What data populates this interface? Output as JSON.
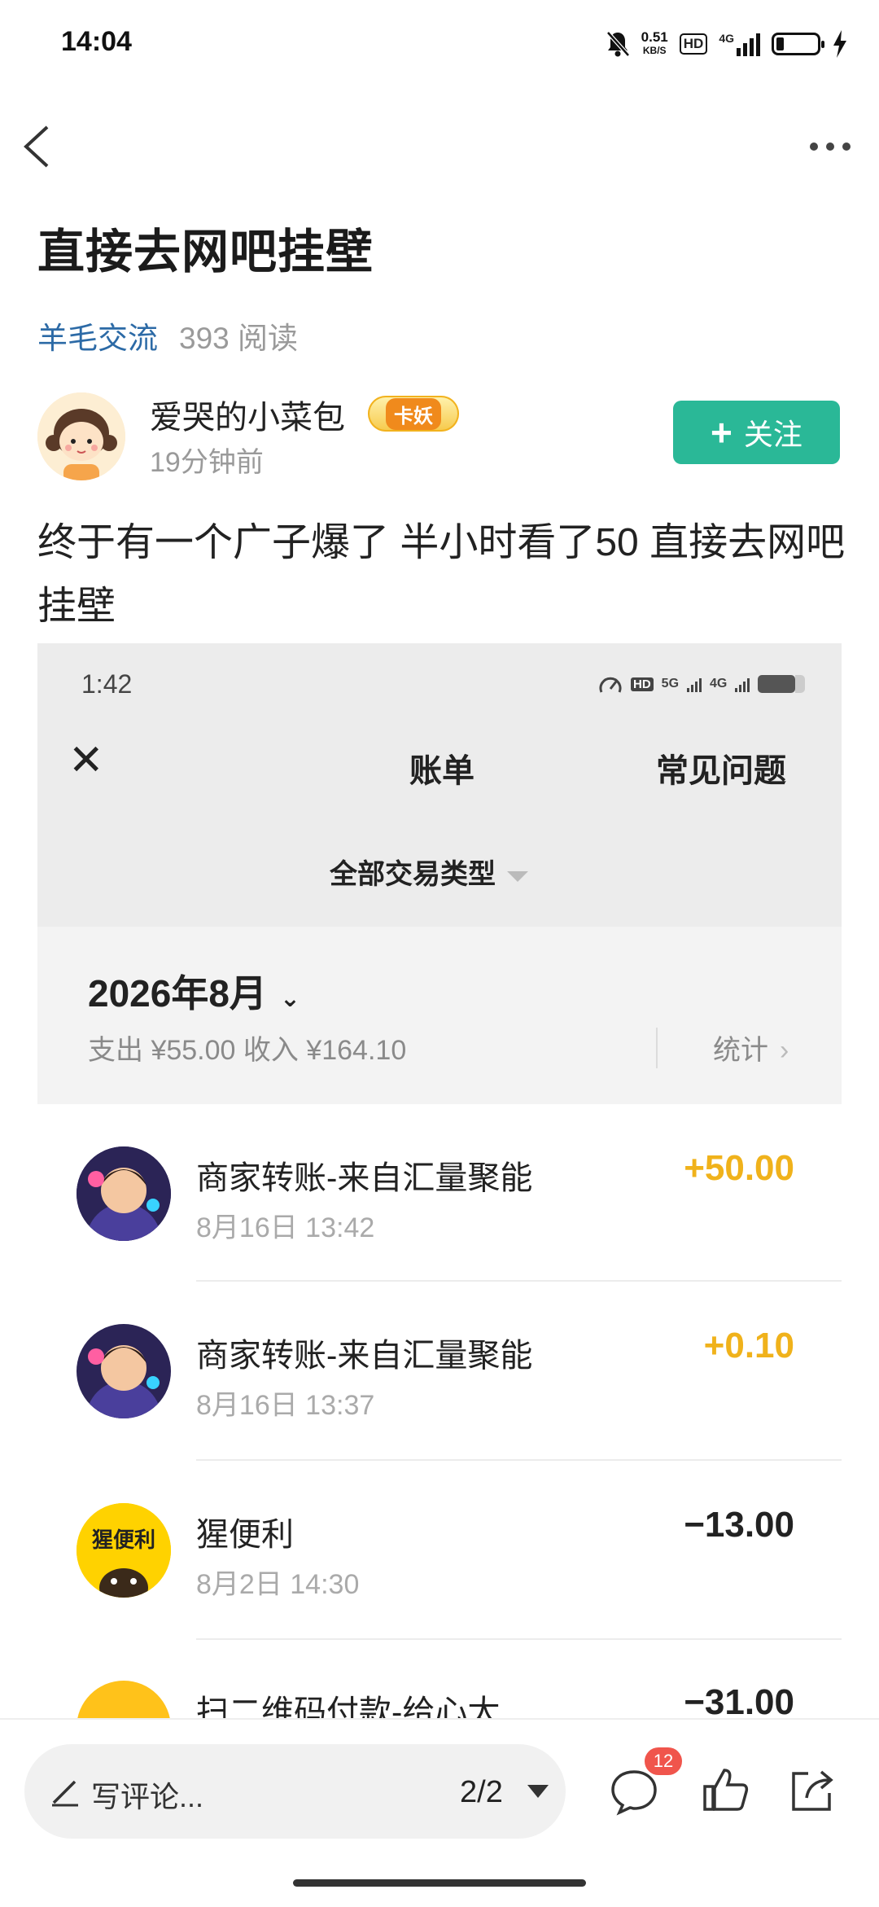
{
  "status_bar": {
    "time": "14:04",
    "net_speed_value": "0.51",
    "net_speed_unit": "KB/S",
    "hd": "HD",
    "signal_type": "4G"
  },
  "post": {
    "title": "直接去网吧挂壁",
    "category": "羊毛交流",
    "reads": "393 阅读",
    "author": "爱哭的小菜包",
    "author_badge": "卡妖",
    "time_ago": "19分钟前",
    "follow_label": "关注",
    "follow_icon": "+",
    "body": "终于有一个广子爆了 半小时看了50 直接去网吧挂壁"
  },
  "screenshot": {
    "status_time": "1:42",
    "status_hd": "HD",
    "status_5g": "5G",
    "status_4g": "4G",
    "close_icon": "✕",
    "title": "账单",
    "faq": "常见问题",
    "filter": "全部交易类型",
    "month": "2026年8月",
    "summary": "支出 ¥55.00 收入 ¥164.10",
    "stats": "统计",
    "transactions": [
      {
        "name": "商家转账-来自汇量聚能",
        "date": "8月16日 13:42",
        "amount": "+50.00",
        "amount_color": "#f0b21b"
      },
      {
        "name": "商家转账-来自汇量聚能",
        "date": "8月16日 13:37",
        "amount": "+0.10",
        "amount_color": "#f0b21b"
      },
      {
        "name": "猩便利",
        "date": "8月2日 14:30",
        "amount": "−13.00",
        "amount_color": "#222222"
      },
      {
        "name": "扫二维码付款-给心太…",
        "date": "",
        "amount": "−31.00",
        "amount_color": "#222222"
      }
    ],
    "store_avatar_text": "猩便利"
  },
  "bottom": {
    "comment_placeholder": "写评论...",
    "page_indicator": "2/2",
    "comment_count": "12"
  },
  "colors": {
    "accent": "#2ab897",
    "link": "#2c6aa6",
    "income": "#f0b21b",
    "badge": "#f0554c"
  }
}
